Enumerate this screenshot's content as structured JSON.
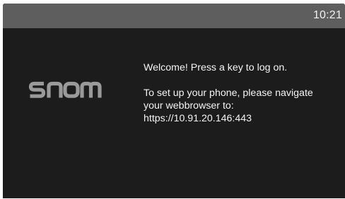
{
  "status_bar": {
    "time": "10:21"
  },
  "logo": {
    "text": "snom",
    "color": "#9a9a9a"
  },
  "message": {
    "welcome": "Welcome! Press a key to log on.",
    "setup_line1": "To set up your phone, please navigate",
    "setup_line2": "your webbrowser to:",
    "url": "https://10.91.20.146:443"
  },
  "colors": {
    "background": "#1c1c1c",
    "status_bar": "#5e5e5e",
    "text": "#f4f4f4"
  }
}
